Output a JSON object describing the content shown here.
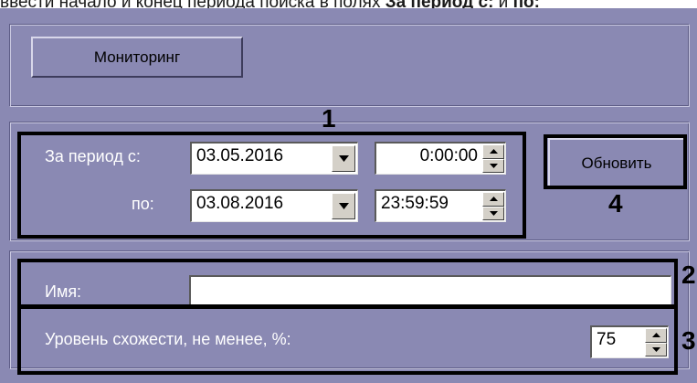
{
  "caption": {
    "text": "ввести начало и конец периода поиска в полях ",
    "bold1": "За период с:",
    "mid": " и ",
    "bold2": "по:"
  },
  "monitoring_button": "Мониторинг",
  "period": {
    "from_label": "За период с:",
    "from_date": "03.05.2016",
    "from_time": "0:00:00",
    "to_label": "по:",
    "to_date": "03.08.2016",
    "to_time": "23:59:59"
  },
  "refresh_button": "Обновить",
  "name": {
    "label": "Имя:",
    "value": ""
  },
  "similarity": {
    "label": "Уровень схожести, не менее, %:",
    "value": "75"
  },
  "annotations": {
    "n1": "1",
    "n2": "2",
    "n3": "3",
    "n4": "4"
  },
  "icons": {
    "dropdown": "chevron-down-icon",
    "spin_up": "arrow-up-icon",
    "spin_down": "arrow-down-icon"
  },
  "colors": {
    "panel": "#8a89b3",
    "field": "#ffffff",
    "control": "#d4d0c8"
  }
}
